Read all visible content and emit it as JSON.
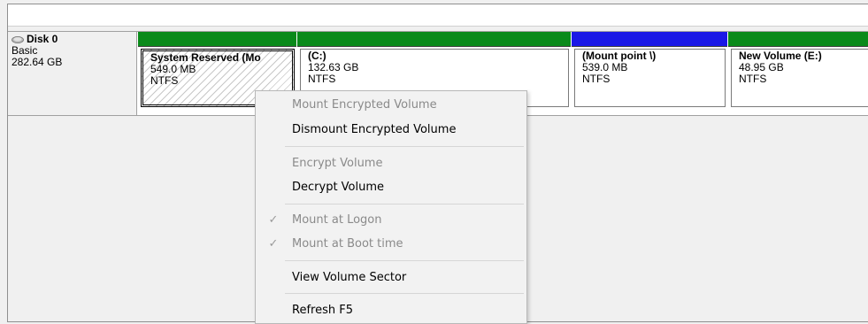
{
  "disk": {
    "name": "Disk 0",
    "type": "Basic",
    "size": "282.64 GB",
    "icon": "disk-drive-icon"
  },
  "partitions": [
    {
      "name": "System Reserved (Mo",
      "size": "549.0 MB",
      "fs": "NTFS",
      "bar_color": "#0a8a1a",
      "selected": true
    },
    {
      "name": "(C:)",
      "size": "132.63 GB",
      "fs": "NTFS",
      "bar_color": "#0a8a1a",
      "selected": false
    },
    {
      "name": "(Mount point \\)",
      "size": "539.0 MB",
      "fs": "NTFS",
      "bar_color": "#1a18e6",
      "selected": false
    },
    {
      "name": "New Volume  (E:)",
      "size": "48.95 GB",
      "fs": "NTFS",
      "bar_color": "#0a8a1a",
      "selected": false
    }
  ],
  "context_menu": {
    "items": [
      {
        "label": "Mount Encrypted Volume",
        "enabled": false,
        "checked": false
      },
      {
        "label": "Dismount Encrypted Volume",
        "enabled": true,
        "checked": false
      },
      {
        "label": "Encrypt Volume",
        "enabled": false,
        "checked": false
      },
      {
        "label": "Decrypt Volume",
        "enabled": true,
        "checked": false
      },
      {
        "label": "Mount at Logon",
        "enabled": false,
        "checked": true
      },
      {
        "label": "Mount at Boot time",
        "enabled": false,
        "checked": true
      },
      {
        "label": "View Volume Sector",
        "enabled": true,
        "checked": false
      },
      {
        "label": "Refresh  F5",
        "enabled": true,
        "checked": false
      }
    ],
    "check_glyph": "✓"
  }
}
